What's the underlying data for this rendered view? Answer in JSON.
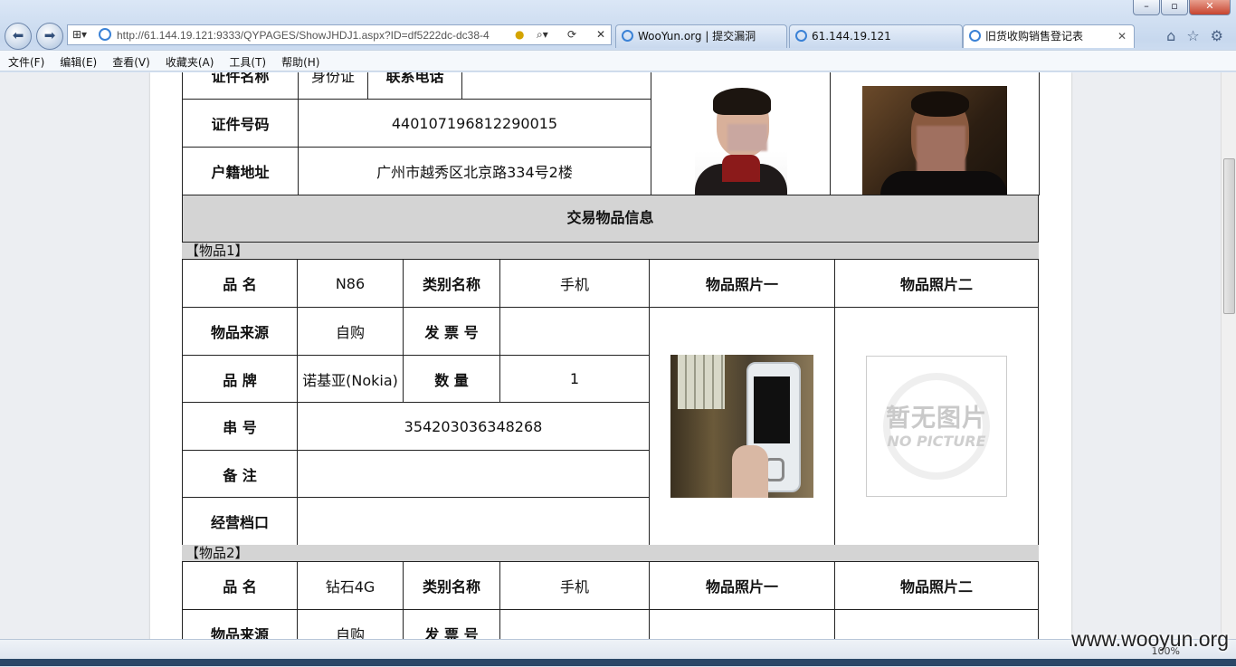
{
  "browser": {
    "url": "http://61.144.19.121:9333/QYPAGES/ShowJHDJ1.aspx?ID=df5222dc-dc38-4",
    "tabs": [
      {
        "label": "WooYun.org | 提交漏洞",
        "active": false
      },
      {
        "label": "61.144.19.121",
        "active": false
      },
      {
        "label": "旧货收购销售登记表",
        "active": true
      }
    ],
    "menu": [
      "文件(F)",
      "编辑(E)",
      "查看(V)",
      "收藏夹(A)",
      "工具(T)",
      "帮助(H)"
    ],
    "zoom": "100%",
    "watermark": "www.wooyun.org"
  },
  "person": {
    "row0": {
      "label1": "证件名称",
      "value1": "身份证",
      "label2": "联系电话",
      "value2": ""
    },
    "id_label": "证件号码",
    "id_value": "440107196812290015",
    "addr_label": "户籍地址",
    "addr_value": "广州市越秀区北京路334号2楼"
  },
  "section_title": "交易物品信息",
  "items": [
    {
      "header": "【物品1】",
      "name_label": "品  名",
      "name": "N86",
      "cat_label": "类别名称",
      "cat": "手机",
      "photo1_label": "物品照片一",
      "photo2_label": "物品照片二",
      "source_label": "物品来源",
      "source": "自购",
      "invoice_label": "发 票 号",
      "invoice": "",
      "brand_label": "品  牌",
      "brand": "诺基亚(Nokia)",
      "qty_label": "数  量",
      "qty": "1",
      "serial_label": "串  号",
      "serial": "354203036348268",
      "note_label": "备  注",
      "note": "",
      "stall_label": "经营档口",
      "stall": "",
      "nopic_cn": "暂无图片",
      "nopic_en": "NO PICTURE"
    },
    {
      "header": "【物品2】",
      "name_label": "品  名",
      "name": "钻石4G",
      "cat_label": "类别名称",
      "cat": "手机",
      "photo1_label": "物品照片一",
      "photo2_label": "物品照片二",
      "source_label": "物品来源",
      "source": "自购",
      "invoice_label": "发 票 号",
      "invoice": ""
    }
  ]
}
